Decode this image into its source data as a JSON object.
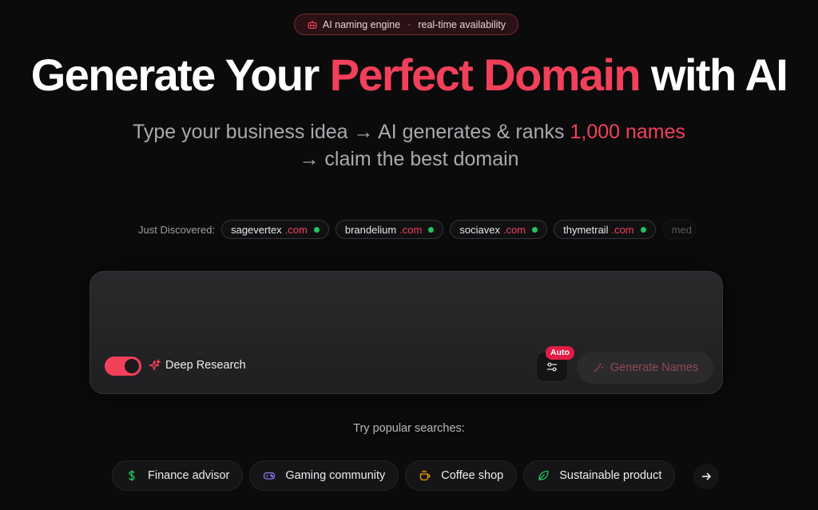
{
  "badge": {
    "left": "AI naming engine",
    "separator": "·",
    "right": "real-time availability"
  },
  "hero": {
    "pre": "Generate Your ",
    "accent": "Perfect Domain",
    "post": " with AI"
  },
  "subtitle": {
    "pre": "Type your business idea → AI generates & ranks ",
    "accent": "1,000 names",
    "post": " → claim the best domain"
  },
  "discovered": {
    "label": "Just Discovered:",
    "items": [
      {
        "name": "sagevertex",
        "tld": ".com"
      },
      {
        "name": "brandelium",
        "tld": ".com"
      },
      {
        "name": "sociavex",
        "tld": ".com"
      },
      {
        "name": "thymetrail",
        "tld": ".com"
      },
      {
        "name": "med",
        "tld": ""
      }
    ]
  },
  "composer": {
    "deep_research_label": "Deep Research",
    "auto_tag": "Auto",
    "generate_label": "Generate Names"
  },
  "popular": {
    "title": "Try popular searches:",
    "items": [
      {
        "label": "Finance advisor",
        "icon": "dollar-icon"
      },
      {
        "label": "Gaming community",
        "icon": "gamepad-icon"
      },
      {
        "label": "Coffee shop",
        "icon": "coffee-icon"
      },
      {
        "label": "Sustainable product",
        "icon": "leaf-icon"
      }
    ]
  },
  "colors": {
    "accent": "#f2405a",
    "live": "#22c55e",
    "background": "#0b0b0c"
  }
}
